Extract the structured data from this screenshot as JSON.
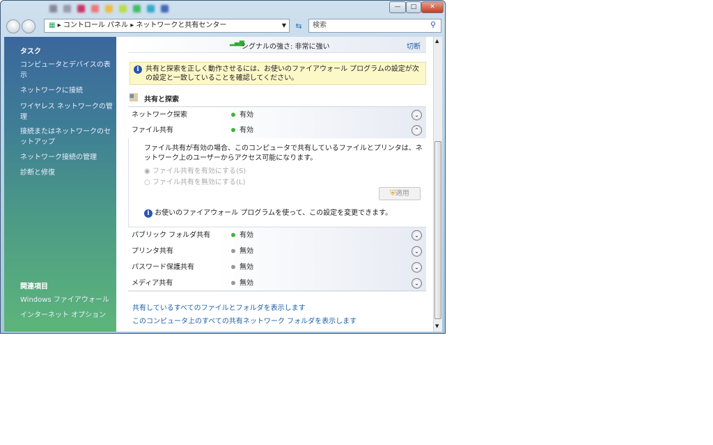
{
  "window": {
    "minimize": "—",
    "maximize": "□",
    "close": "✕"
  },
  "address": {
    "segments": [
      "コントロール パネル",
      "ネットワークと共有センター"
    ],
    "search_placeholder": "検索"
  },
  "sidebar": {
    "tasks_heading": "タスク",
    "tasks": [
      "コンピュータとデバイスの表示",
      "ネットワークに接続",
      "ワイヤレス ネットワークの管理",
      "接続またはネットワークのセットアップ",
      "ネットワーク接続の管理",
      "診断と修復"
    ],
    "related_heading": "関連項目",
    "related": [
      "Windows ファイアウォール",
      "インターネット オプション"
    ]
  },
  "main": {
    "signal": "シグナルの強さ: 非常に強い",
    "disconnect": "切断",
    "notice": "共有と探索を正しく動作させるには、お使いのファイアウォール プログラムの設定が次の設定と一致していることを確認してください。",
    "section_title": "共有と探索",
    "rows": [
      {
        "label": "ネットワーク探索",
        "status": "有効",
        "on": true
      },
      {
        "label": "ファイル共有",
        "status": "有効",
        "on": true
      },
      {
        "label": "パブリック フォルダ共有",
        "status": "有効",
        "on": true
      },
      {
        "label": "プリンタ共有",
        "status": "無効",
        "on": false
      },
      {
        "label": "パスワード保護共有",
        "status": "無効",
        "on": false
      },
      {
        "label": "メディア共有",
        "status": "無効",
        "on": false
      }
    ],
    "expanded": {
      "description": "ファイル共有が有効の場合、このコンピュータで共有しているファイルとプリンタは、ネットワーク上のユーザーからアクセス可能になります。",
      "option_on": "ファイル共有を有効にする(S)",
      "option_off": "ファイル共有を無効にする(L)",
      "apply": "適用",
      "firewall_note": "お使いのファイアウォール プログラムを使って、この設定を変更できます。"
    },
    "links": [
      "共有しているすべてのファイルとフォルダを表示します",
      "このコンピュータ上のすべての共有ネットワーク フォルダを表示します"
    ]
  },
  "colors": {
    "on": "#3db53d",
    "off": "#999999",
    "link": "#1f5fa8"
  }
}
